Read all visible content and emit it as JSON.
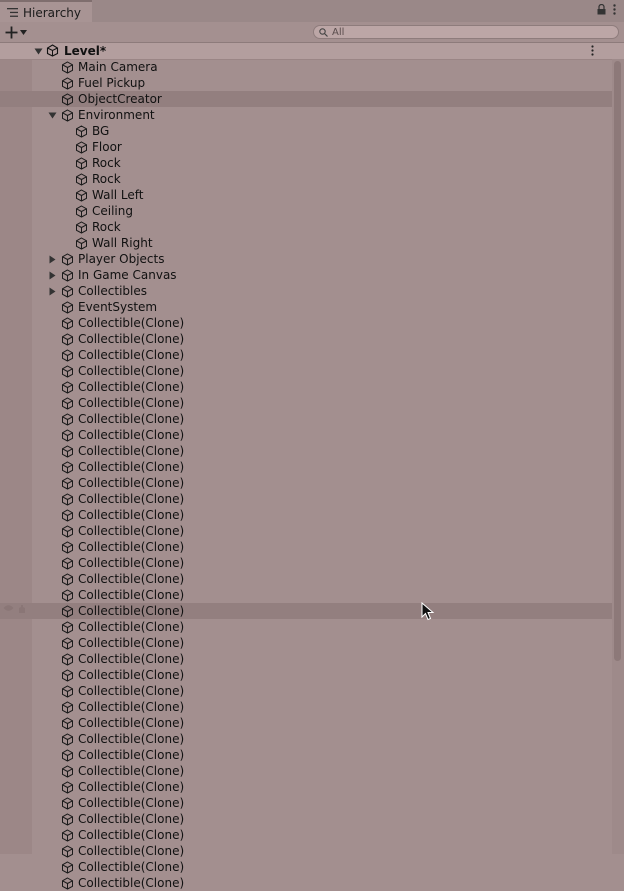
{
  "window": {
    "tab_title": "Hierarchy",
    "tab_icon": "hierarchy-list-icon",
    "lock_icon": "lock-icon",
    "menu_icon": "kebab-menu-icon"
  },
  "toolbar": {
    "add_icon": "plus-icon",
    "dropdown_icon": "dropdown-triangle-icon",
    "search_placeholder": "All",
    "search_icon": "search-icon"
  },
  "scene": {
    "name": "Level*",
    "expanded": true,
    "icon": "unity-scene-icon"
  },
  "items": [
    {
      "label": "Main Camera",
      "depth": 1,
      "expander": "none"
    },
    {
      "label": "Fuel Pickup",
      "depth": 1,
      "expander": "none"
    },
    {
      "label": "ObjectCreator",
      "depth": 1,
      "expander": "none",
      "selected": true
    },
    {
      "label": "Environment",
      "depth": 1,
      "expander": "expanded"
    },
    {
      "label": "BG",
      "depth": 2,
      "expander": "none"
    },
    {
      "label": "Floor",
      "depth": 2,
      "expander": "none"
    },
    {
      "label": "Rock",
      "depth": 2,
      "expander": "none"
    },
    {
      "label": "Rock",
      "depth": 2,
      "expander": "none"
    },
    {
      "label": "Wall Left",
      "depth": 2,
      "expander": "none"
    },
    {
      "label": "Ceiling",
      "depth": 2,
      "expander": "none"
    },
    {
      "label": "Rock",
      "depth": 2,
      "expander": "none"
    },
    {
      "label": "Wall Right",
      "depth": 2,
      "expander": "none"
    },
    {
      "label": "Player Objects",
      "depth": 1,
      "expander": "collapsed"
    },
    {
      "label": "In Game Canvas",
      "depth": 1,
      "expander": "collapsed"
    },
    {
      "label": "Collectibles",
      "depth": 1,
      "expander": "collapsed"
    },
    {
      "label": "EventSystem",
      "depth": 1,
      "expander": "none"
    },
    {
      "label": "Collectible(Clone)",
      "depth": 1,
      "expander": "none"
    },
    {
      "label": "Collectible(Clone)",
      "depth": 1,
      "expander": "none"
    },
    {
      "label": "Collectible(Clone)",
      "depth": 1,
      "expander": "none"
    },
    {
      "label": "Collectible(Clone)",
      "depth": 1,
      "expander": "none"
    },
    {
      "label": "Collectible(Clone)",
      "depth": 1,
      "expander": "none"
    },
    {
      "label": "Collectible(Clone)",
      "depth": 1,
      "expander": "none"
    },
    {
      "label": "Collectible(Clone)",
      "depth": 1,
      "expander": "none"
    },
    {
      "label": "Collectible(Clone)",
      "depth": 1,
      "expander": "none"
    },
    {
      "label": "Collectible(Clone)",
      "depth": 1,
      "expander": "none"
    },
    {
      "label": "Collectible(Clone)",
      "depth": 1,
      "expander": "none"
    },
    {
      "label": "Collectible(Clone)",
      "depth": 1,
      "expander": "none"
    },
    {
      "label": "Collectible(Clone)",
      "depth": 1,
      "expander": "none"
    },
    {
      "label": "Collectible(Clone)",
      "depth": 1,
      "expander": "none"
    },
    {
      "label": "Collectible(Clone)",
      "depth": 1,
      "expander": "none"
    },
    {
      "label": "Collectible(Clone)",
      "depth": 1,
      "expander": "none"
    },
    {
      "label": "Collectible(Clone)",
      "depth": 1,
      "expander": "none"
    },
    {
      "label": "Collectible(Clone)",
      "depth": 1,
      "expander": "none"
    },
    {
      "label": "Collectible(Clone)",
      "depth": 1,
      "expander": "none"
    },
    {
      "label": "Collectible(Clone)",
      "depth": 1,
      "expander": "none",
      "hovered": true
    },
    {
      "label": "Collectible(Clone)",
      "depth": 1,
      "expander": "none"
    },
    {
      "label": "Collectible(Clone)",
      "depth": 1,
      "expander": "none"
    },
    {
      "label": "Collectible(Clone)",
      "depth": 1,
      "expander": "none"
    },
    {
      "label": "Collectible(Clone)",
      "depth": 1,
      "expander": "none"
    },
    {
      "label": "Collectible(Clone)",
      "depth": 1,
      "expander": "none"
    },
    {
      "label": "Collectible(Clone)",
      "depth": 1,
      "expander": "none"
    },
    {
      "label": "Collectible(Clone)",
      "depth": 1,
      "expander": "none"
    },
    {
      "label": "Collectible(Clone)",
      "depth": 1,
      "expander": "none"
    },
    {
      "label": "Collectible(Clone)",
      "depth": 1,
      "expander": "none"
    },
    {
      "label": "Collectible(Clone)",
      "depth": 1,
      "expander": "none"
    },
    {
      "label": "Collectible(Clone)",
      "depth": 1,
      "expander": "none"
    },
    {
      "label": "Collectible(Clone)",
      "depth": 1,
      "expander": "none"
    },
    {
      "label": "Collectible(Clone)",
      "depth": 1,
      "expander": "none"
    },
    {
      "label": "Collectible(Clone)",
      "depth": 1,
      "expander": "none"
    },
    {
      "label": "Collectible(Clone)",
      "depth": 1,
      "expander": "none"
    },
    {
      "label": "Collectible(Clone)",
      "depth": 1,
      "expander": "none"
    },
    {
      "label": "Collectible(Clone)",
      "depth": 1,
      "expander": "none"
    }
  ],
  "colors": {
    "panel_bg": "#a38f8f",
    "selected_row": "#937f7f",
    "text": "#111111"
  }
}
